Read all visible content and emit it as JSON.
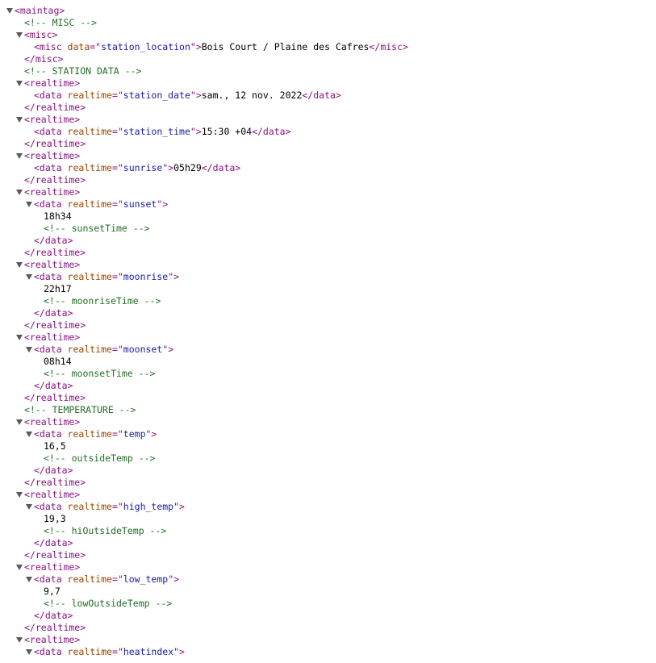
{
  "lines": [
    {
      "i": 0,
      "tri": true,
      "parts": [
        [
          "tag",
          "<maintag>"
        ]
      ]
    },
    {
      "i": 1,
      "parts": [
        [
          "cm",
          "<!-- MISC -->"
        ]
      ]
    },
    {
      "i": 1,
      "tri": true,
      "parts": [
        [
          "tag",
          "<misc>"
        ]
      ]
    },
    {
      "i": 2,
      "parts": [
        [
          "tag",
          "<misc "
        ],
        [
          "an",
          "data"
        ],
        [
          "tag",
          "=\""
        ],
        [
          "av",
          "station_location"
        ],
        [
          "tag",
          "\">"
        ],
        [
          "tx",
          "Bois Court / Plaine des Cafres"
        ],
        [
          "tag",
          "</misc>"
        ]
      ]
    },
    {
      "i": 1,
      "parts": [
        [
          "tag",
          "</misc>"
        ]
      ]
    },
    {
      "i": 1,
      "parts": [
        [
          "cm",
          "<!-- STATION DATA -->"
        ]
      ]
    },
    {
      "i": 1,
      "tri": true,
      "parts": [
        [
          "tag",
          "<realtime>"
        ]
      ]
    },
    {
      "i": 2,
      "parts": [
        [
          "tag",
          "<data "
        ],
        [
          "an",
          "realtime"
        ],
        [
          "tag",
          "=\""
        ],
        [
          "av",
          "station_date"
        ],
        [
          "tag",
          "\">"
        ],
        [
          "tx",
          "sam., 12 nov. 2022"
        ],
        [
          "tag",
          "</data>"
        ]
      ]
    },
    {
      "i": 1,
      "parts": [
        [
          "tag",
          "</realtime>"
        ]
      ]
    },
    {
      "i": 1,
      "tri": true,
      "parts": [
        [
          "tag",
          "<realtime>"
        ]
      ]
    },
    {
      "i": 2,
      "parts": [
        [
          "tag",
          "<data "
        ],
        [
          "an",
          "realtime"
        ],
        [
          "tag",
          "=\""
        ],
        [
          "av",
          "station_time"
        ],
        [
          "tag",
          "\">"
        ],
        [
          "tx",
          "15:30 +04"
        ],
        [
          "tag",
          "</data>"
        ]
      ]
    },
    {
      "i": 1,
      "parts": [
        [
          "tag",
          "</realtime>"
        ]
      ]
    },
    {
      "i": 1,
      "tri": true,
      "parts": [
        [
          "tag",
          "<realtime>"
        ]
      ]
    },
    {
      "i": 2,
      "parts": [
        [
          "tag",
          "<data "
        ],
        [
          "an",
          "realtime"
        ],
        [
          "tag",
          "=\""
        ],
        [
          "av",
          "sunrise"
        ],
        [
          "tag",
          "\">"
        ],
        [
          "tx",
          "05h29"
        ],
        [
          "tag",
          "</data>"
        ]
      ]
    },
    {
      "i": 1,
      "parts": [
        [
          "tag",
          "</realtime>"
        ]
      ]
    },
    {
      "i": 1,
      "tri": true,
      "parts": [
        [
          "tag",
          "<realtime>"
        ]
      ]
    },
    {
      "i": 2,
      "tri": true,
      "parts": [
        [
          "tag",
          "<data "
        ],
        [
          "an",
          "realtime"
        ],
        [
          "tag",
          "=\""
        ],
        [
          "av",
          "sunset"
        ],
        [
          "tag",
          "\">"
        ]
      ]
    },
    {
      "i": 3,
      "parts": [
        [
          "tx",
          "18h34"
        ]
      ]
    },
    {
      "i": 3,
      "parts": [
        [
          "cm",
          "<!-- sunsetTime -->"
        ]
      ]
    },
    {
      "i": 2,
      "parts": [
        [
          "tag",
          "</data>"
        ]
      ]
    },
    {
      "i": 1,
      "parts": [
        [
          "tag",
          "</realtime>"
        ]
      ]
    },
    {
      "i": 1,
      "tri": true,
      "parts": [
        [
          "tag",
          "<realtime>"
        ]
      ]
    },
    {
      "i": 2,
      "tri": true,
      "parts": [
        [
          "tag",
          "<data "
        ],
        [
          "an",
          "realtime"
        ],
        [
          "tag",
          "=\""
        ],
        [
          "av",
          "moonrise"
        ],
        [
          "tag",
          "\">"
        ]
      ]
    },
    {
      "i": 3,
      "parts": [
        [
          "tx",
          "22h17"
        ]
      ]
    },
    {
      "i": 3,
      "parts": [
        [
          "cm",
          "<!-- moonriseTime -->"
        ]
      ]
    },
    {
      "i": 2,
      "parts": [
        [
          "tag",
          "</data>"
        ]
      ]
    },
    {
      "i": 1,
      "parts": [
        [
          "tag",
          "</realtime>"
        ]
      ]
    },
    {
      "i": 1,
      "tri": true,
      "parts": [
        [
          "tag",
          "<realtime>"
        ]
      ]
    },
    {
      "i": 2,
      "tri": true,
      "parts": [
        [
          "tag",
          "<data "
        ],
        [
          "an",
          "realtime"
        ],
        [
          "tag",
          "=\""
        ],
        [
          "av",
          "moonset"
        ],
        [
          "tag",
          "\">"
        ]
      ]
    },
    {
      "i": 3,
      "parts": [
        [
          "tx",
          "08h14"
        ]
      ]
    },
    {
      "i": 3,
      "parts": [
        [
          "cm",
          "<!-- moonsetTime -->"
        ]
      ]
    },
    {
      "i": 2,
      "parts": [
        [
          "tag",
          "</data>"
        ]
      ]
    },
    {
      "i": 1,
      "parts": [
        [
          "tag",
          "</realtime>"
        ]
      ]
    },
    {
      "i": 1,
      "parts": [
        [
          "cm",
          "<!-- TEMPERATURE -->"
        ]
      ]
    },
    {
      "i": 1,
      "tri": true,
      "parts": [
        [
          "tag",
          "<realtime>"
        ]
      ]
    },
    {
      "i": 2,
      "tri": true,
      "parts": [
        [
          "tag",
          "<data "
        ],
        [
          "an",
          "realtime"
        ],
        [
          "tag",
          "=\""
        ],
        [
          "av",
          "temp"
        ],
        [
          "tag",
          "\">"
        ]
      ]
    },
    {
      "i": 3,
      "parts": [
        [
          "tx",
          "16,5"
        ]
      ]
    },
    {
      "i": 3,
      "parts": [
        [
          "cm",
          "<!-- outsideTemp -->"
        ]
      ]
    },
    {
      "i": 2,
      "parts": [
        [
          "tag",
          "</data>"
        ]
      ]
    },
    {
      "i": 1,
      "parts": [
        [
          "tag",
          "</realtime>"
        ]
      ]
    },
    {
      "i": 1,
      "tri": true,
      "parts": [
        [
          "tag",
          "<realtime>"
        ]
      ]
    },
    {
      "i": 2,
      "tri": true,
      "parts": [
        [
          "tag",
          "<data "
        ],
        [
          "an",
          "realtime"
        ],
        [
          "tag",
          "=\""
        ],
        [
          "av",
          "high_temp"
        ],
        [
          "tag",
          "\">"
        ]
      ]
    },
    {
      "i": 3,
      "parts": [
        [
          "tx",
          "19,3"
        ]
      ]
    },
    {
      "i": 3,
      "parts": [
        [
          "cm",
          "<!-- hiOutsideTemp -->"
        ]
      ]
    },
    {
      "i": 2,
      "parts": [
        [
          "tag",
          "</data>"
        ]
      ]
    },
    {
      "i": 1,
      "parts": [
        [
          "tag",
          "</realtime>"
        ]
      ]
    },
    {
      "i": 1,
      "tri": true,
      "parts": [
        [
          "tag",
          "<realtime>"
        ]
      ]
    },
    {
      "i": 2,
      "tri": true,
      "parts": [
        [
          "tag",
          "<data "
        ],
        [
          "an",
          "realtime"
        ],
        [
          "tag",
          "=\""
        ],
        [
          "av",
          "low_temp"
        ],
        [
          "tag",
          "\">"
        ]
      ]
    },
    {
      "i": 3,
      "parts": [
        [
          "tx",
          "9,7"
        ]
      ]
    },
    {
      "i": 3,
      "parts": [
        [
          "cm",
          "<!-- lowOutsideTemp -->"
        ]
      ]
    },
    {
      "i": 2,
      "parts": [
        [
          "tag",
          "</data>"
        ]
      ]
    },
    {
      "i": 1,
      "parts": [
        [
          "tag",
          "</realtime>"
        ]
      ]
    },
    {
      "i": 1,
      "tri": true,
      "parts": [
        [
          "tag",
          "<realtime>"
        ]
      ]
    },
    {
      "i": 2,
      "tri": true,
      "parts": [
        [
          "tag",
          "<data "
        ],
        [
          "an",
          "realtime"
        ],
        [
          "tag",
          "=\""
        ],
        [
          "av",
          "heatindex"
        ],
        [
          "tag",
          "\">"
        ]
      ]
    }
  ]
}
